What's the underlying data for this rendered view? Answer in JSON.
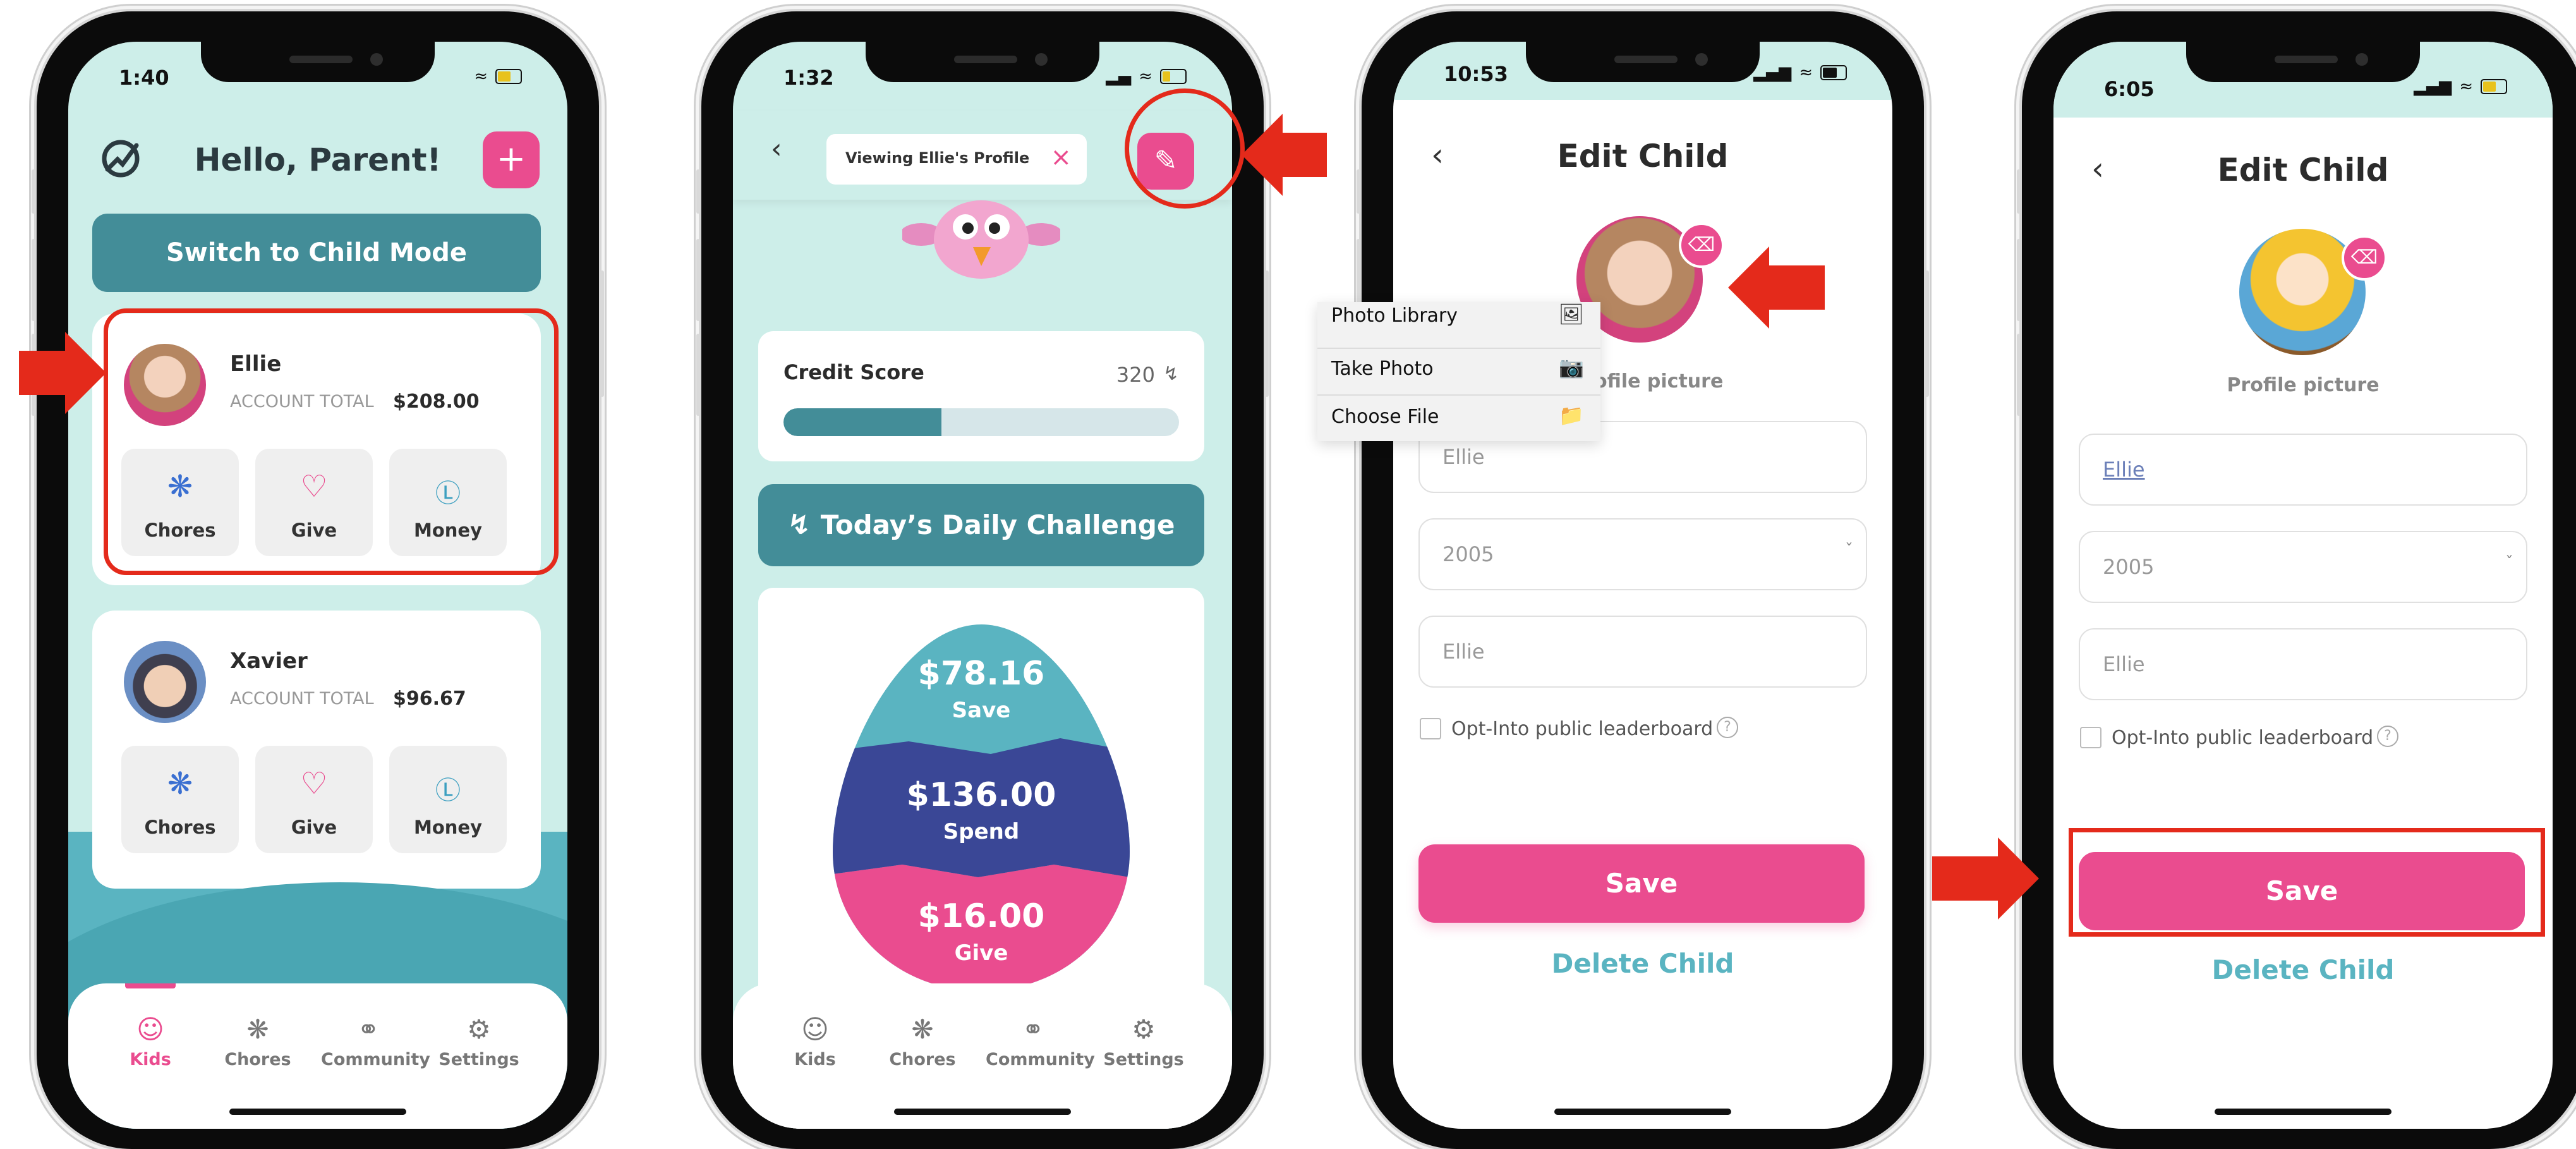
{
  "colors": {
    "teal": "#438d98",
    "mint": "#cdeee9",
    "pink": "#ea4c8f",
    "navy": "#3a4796",
    "light_teal": "#5ab4c1",
    "red_annotation": "#e42a1b"
  },
  "screen1": {
    "time": "1:40",
    "greeting": "Hello, Parent!",
    "add_icon": "plus-icon",
    "switch_button": "Switch to Child Mode",
    "kids": [
      {
        "name": "Ellie",
        "total_label": "ACCOUNT TOTAL",
        "total": "$208.00"
      },
      {
        "name": "Xavier",
        "total_label": "ACCOUNT TOTAL",
        "total": "$96.67"
      }
    ],
    "tiles": [
      "Chores",
      "Give",
      "Money"
    ],
    "nav": [
      "Kids",
      "Chores",
      "Community",
      "Settings"
    ]
  },
  "screen2": {
    "time": "1:32",
    "viewing_label": "Viewing Ellie's Profile",
    "credit_label": "Credit Score",
    "credit_value": "320",
    "credit_progress": 0.4,
    "challenge_label": "Today’s Daily Challenge",
    "save_amount": "$78.16",
    "save_label": "Save",
    "spend_amount": "$136.00",
    "spend_label": "Spend",
    "give_amount": "$16.00",
    "give_label": "Give",
    "nav": [
      "Kids",
      "Chores",
      "Community",
      "Settings"
    ]
  },
  "screen3": {
    "time": "10:53",
    "title": "Edit Child",
    "profile_label_partial": "ofile picture",
    "menu": [
      {
        "label": "Photo Library",
        "icon": "photo-library-icon"
      },
      {
        "label": "Take Photo",
        "icon": "camera-icon"
      },
      {
        "label": "Choose File",
        "icon": "folder-icon"
      }
    ],
    "name_value": "Ellie",
    "year_value": "2005",
    "nickname_value": "Ellie",
    "optin_label": "Opt-Into public leaderboard",
    "save_button": "Save",
    "delete_button": "Delete Child"
  },
  "screen4": {
    "time": "6:05",
    "title": "Edit Child",
    "profile_label": "Profile picture",
    "name_value": "Ellie",
    "year_value": "2005",
    "nickname_value": "Ellie",
    "optin_label": "Opt-Into public leaderboard",
    "save_button": "Save",
    "delete_button": "Delete Child"
  }
}
